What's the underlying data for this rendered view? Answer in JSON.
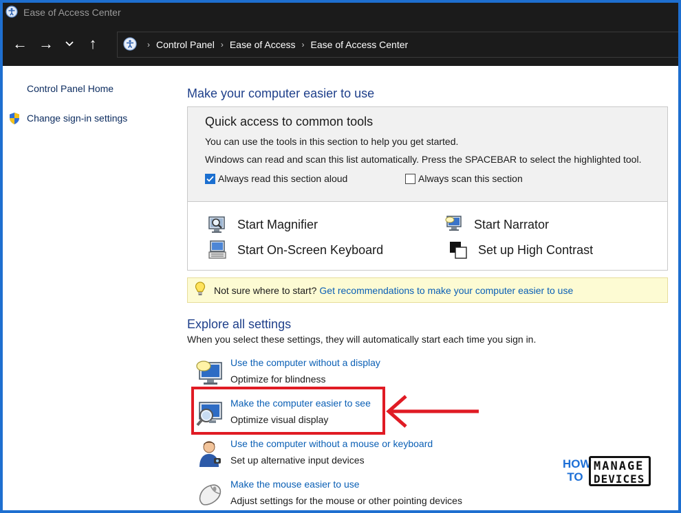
{
  "window": {
    "title": "Ease of Access Center"
  },
  "nav": {
    "back_glyph": "←",
    "forward_glyph": "→",
    "recent_glyph": "⌄",
    "up_glyph": "↑",
    "breadcrumb": [
      "Control Panel",
      "Ease of Access",
      "Ease of Access Center"
    ],
    "separator": "›"
  },
  "sidebar": {
    "home": "Control Panel Home",
    "signin": "Change sign-in settings"
  },
  "main": {
    "heading": "Make your computer easier to use",
    "quick_access": {
      "title": "Quick access to common tools",
      "line1": "You can use the tools in this section to help you get started.",
      "line2": "Windows can read and scan this list automatically.  Press the SPACEBAR to select the highlighted tool.",
      "read_aloud_label": "Always read this section aloud",
      "read_aloud_checked": true,
      "scan_label": "Always scan this section",
      "scan_checked": false,
      "tools": {
        "magnifier": "Start Magnifier",
        "narrator": "Start Narrator",
        "keyboard": "Start On-Screen Keyboard",
        "contrast": "Set up High Contrast"
      }
    },
    "tip": {
      "text": "Not sure where to start?",
      "link": "Get recommendations to make your computer easier to use"
    },
    "explore": {
      "heading": "Explore all settings",
      "subtitle": "When you select these settings, they will automatically start each time you sign in.",
      "items": [
        {
          "link": "Use the computer without a display",
          "desc": "Optimize for blindness"
        },
        {
          "link": "Make the computer easier to see",
          "desc": "Optimize visual display"
        },
        {
          "link": "Use the computer without a mouse or keyboard",
          "desc": "Set up alternative input devices"
        },
        {
          "link": "Make the mouse easier to use",
          "desc": "Adjust settings for the mouse or other pointing devices"
        }
      ]
    }
  },
  "watermark": {
    "how": "HOW",
    "to": "TO",
    "manage": "MANAGE",
    "devices": "DEVICES"
  },
  "colors": {
    "accent": "#1b6fd0",
    "highlight": "#e01b24",
    "link": "#0a5fb5"
  }
}
